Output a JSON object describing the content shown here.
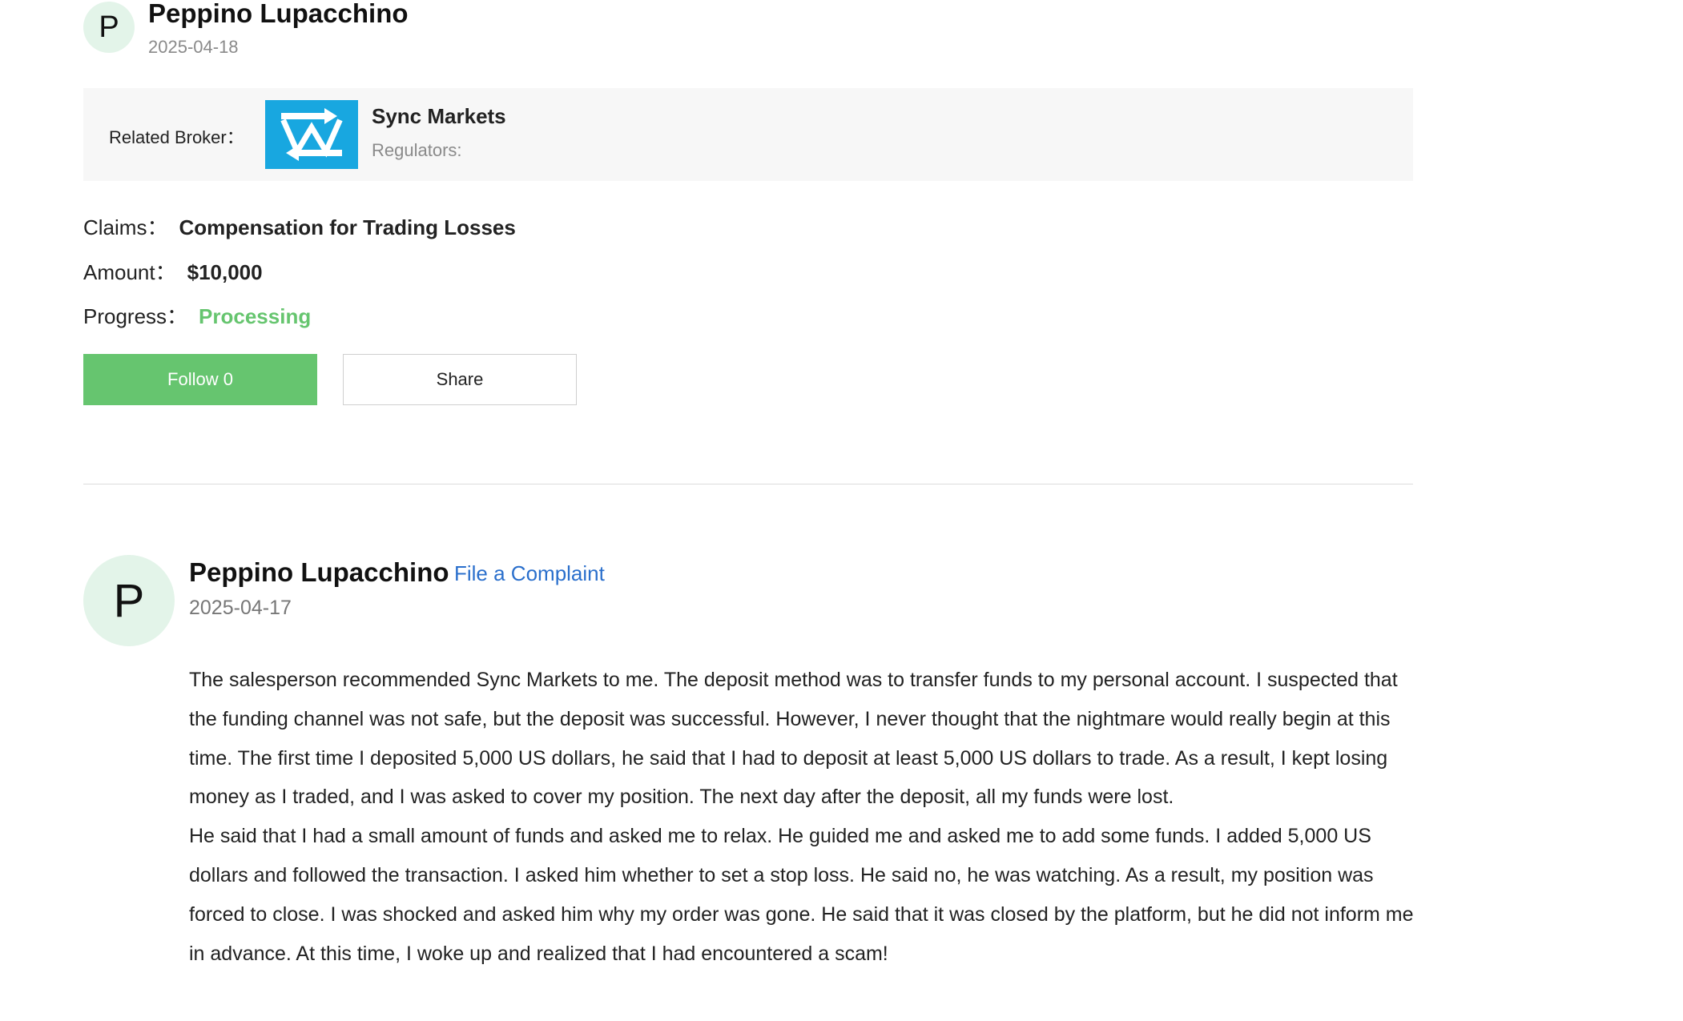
{
  "header": {
    "avatar_letter": "P",
    "user_name": "Peppino Lupacchino",
    "date": "2025-04-18"
  },
  "broker": {
    "label": "Related Broker：",
    "name": "Sync Markets",
    "regulators_label": "Regulators:",
    "logo_icon": "sync-markets-logo",
    "logo_color": "#18a7e0"
  },
  "details": {
    "claims_label": "Claims：",
    "claims_value": "Compensation for Trading Losses",
    "amount_label": "Amount：",
    "amount_value": "$10,000",
    "progress_label": "Progress：",
    "progress_value": "Processing",
    "progress_color": "#66c56f"
  },
  "buttons": {
    "follow_label": "Follow 0",
    "share_label": "Share",
    "follow_color": "#66c56f"
  },
  "post": {
    "avatar_letter": "P",
    "user_name": "Peppino Lupacchino",
    "file_complaint_label": "File a Complaint",
    "link_color": "#2a6fcc",
    "date": "2025-04-17",
    "paragraphs": [
      "The salesperson recommended Sync Markets to me. The deposit method was to transfer funds to my personal account. I suspected that the funding channel was not safe, but the deposit was successful. However, I never thought that the nightmare would really begin at this time. The first time I deposited 5,000 US dollars, he said that I had to deposit at least 5,000 US dollars to trade. As a result, I kept losing money as I traded, and I was asked to cover my position. The next day after the deposit, all my funds were lost.",
      "He said that I had a small amount of funds and asked me to relax. He guided me and asked me to add some funds. I added 5,000 US dollars and followed the transaction. I asked him whether to set a stop loss. He said no, he was watching. As a result, my position was forced to close. I was shocked and asked him why my order was gone. He said that it was closed by the platform, but he did not inform me in advance. At this time, I woke up and realized that I had encountered a scam!"
    ]
  }
}
